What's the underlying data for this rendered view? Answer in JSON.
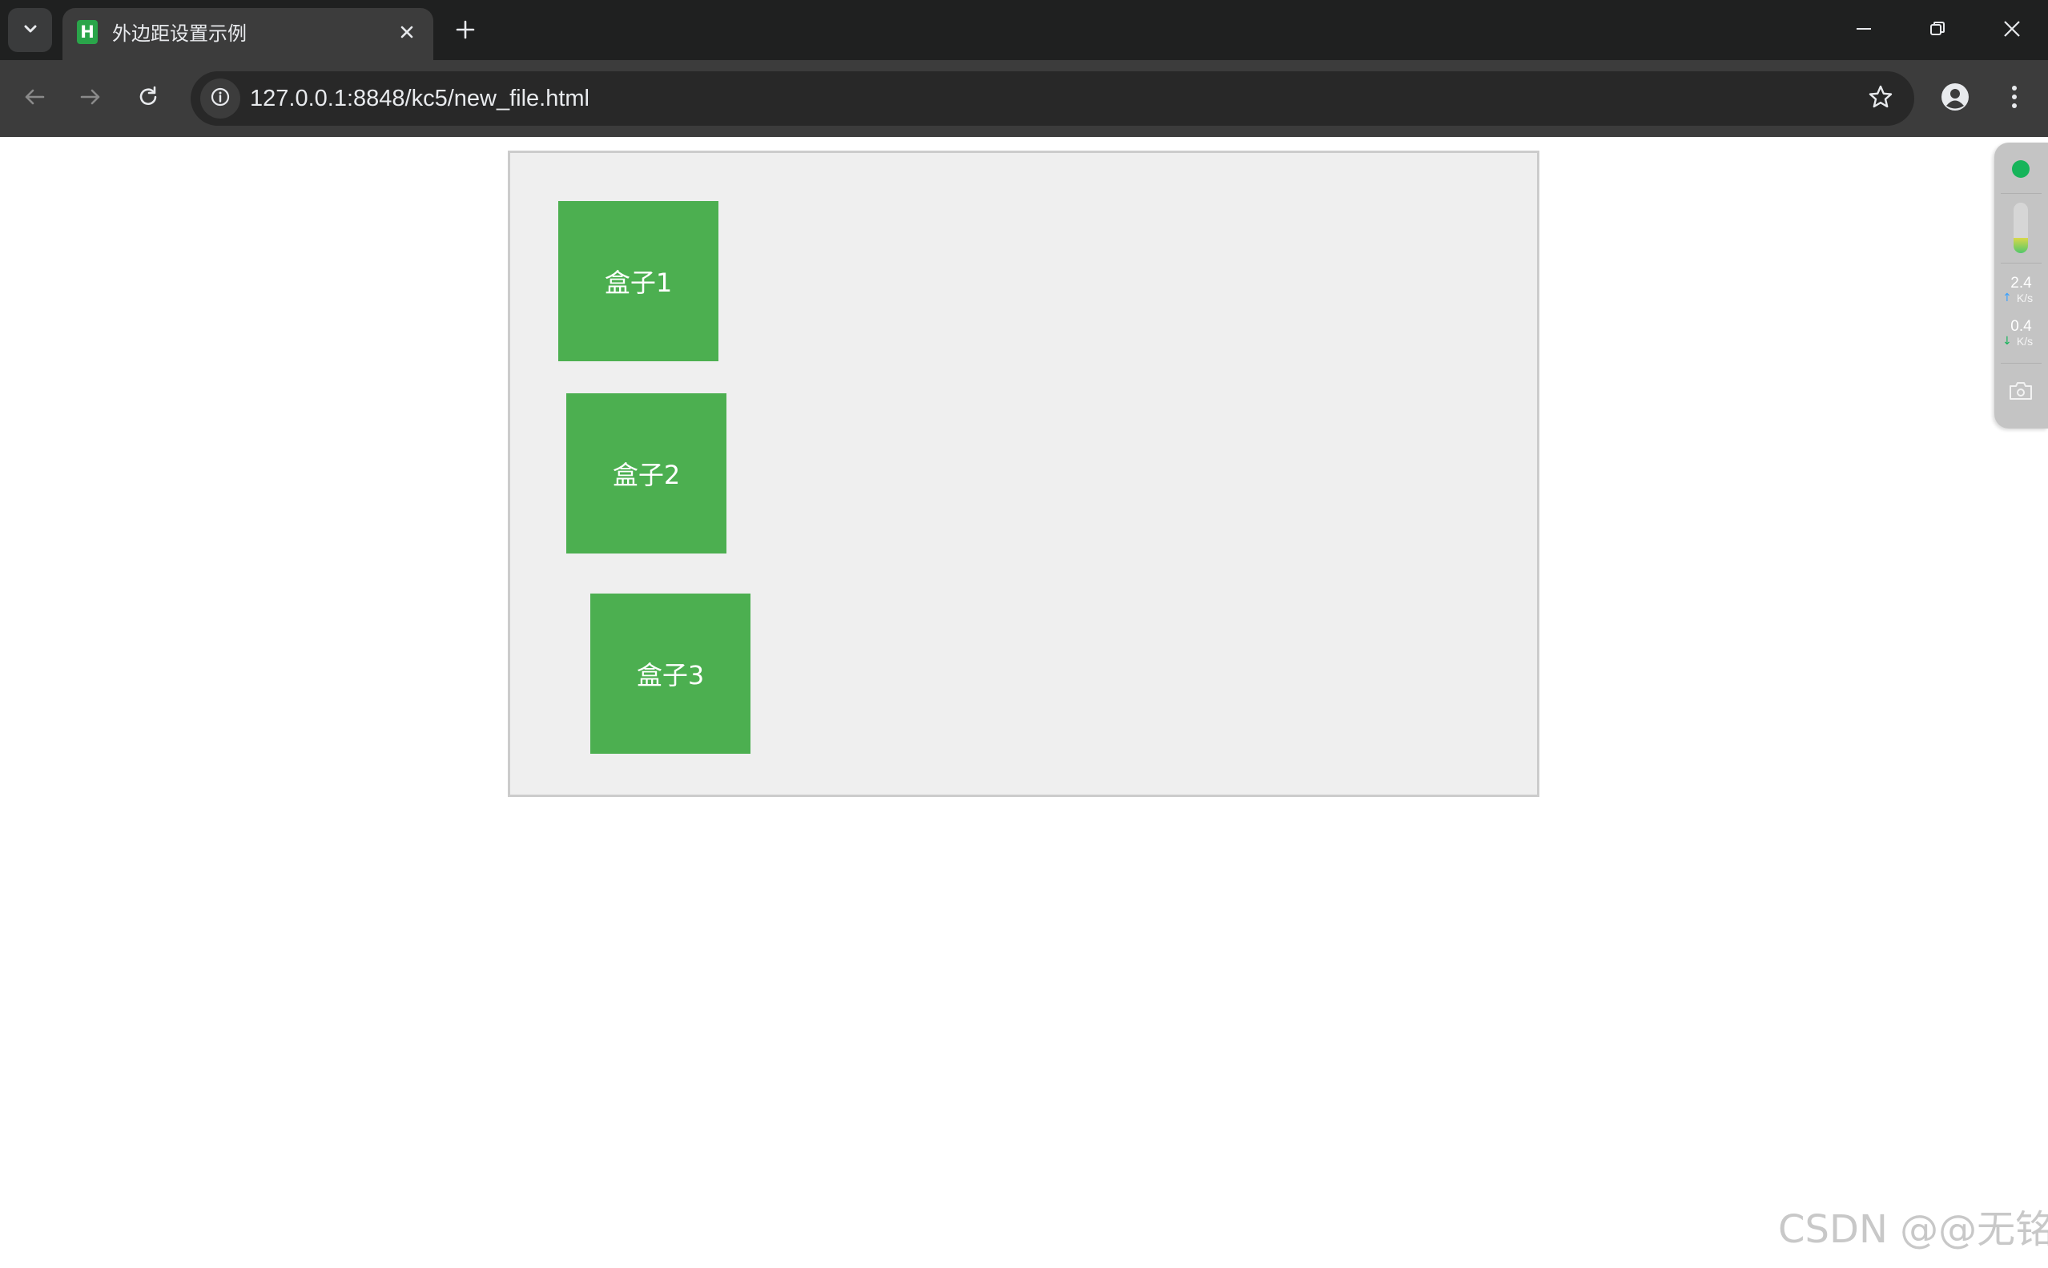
{
  "browser": {
    "tab": {
      "favicon_letter": "H",
      "title": "外边距设置示例"
    },
    "address_bar": {
      "url": "127.0.0.1:8848/kc5/new_file.html"
    }
  },
  "page": {
    "boxes": [
      {
        "label": "盒子1"
      },
      {
        "label": "盒子2"
      },
      {
        "label": "盒子3"
      }
    ],
    "colors": {
      "box": "#4caf50",
      "container": "#efefef",
      "container_border": "#cccccc"
    }
  },
  "monitor_widget": {
    "memory_level_fraction": 0.3,
    "upload_value": "2.4",
    "upload_unit": "K/s",
    "download_value": "0.4",
    "download_unit": "K/s"
  },
  "watermark": "CSDN @@无铭"
}
